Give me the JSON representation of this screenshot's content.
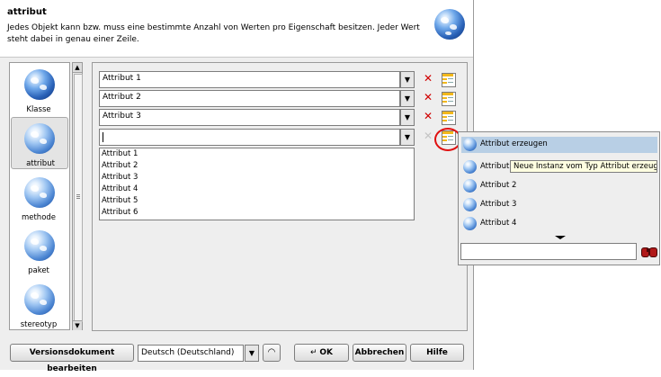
{
  "header": {
    "title": "attribut",
    "description": "Jedes Objekt kann bzw. muss eine bestimmte Anzahl von Werten pro Eigenschaft besitzen. Jeder Wert steht dabei in genau einer Zeile."
  },
  "sidebar": {
    "items": [
      {
        "label": "Klasse",
        "icon": "globe-icon"
      },
      {
        "label": "attribut",
        "icon": "globe-icon",
        "selected": true
      },
      {
        "label": "methode",
        "icon": "globe-icon"
      },
      {
        "label": "paket",
        "icon": "globe-icon"
      },
      {
        "label": "stereotyp",
        "icon": "globe-icon"
      }
    ]
  },
  "fields": [
    {
      "value": "Attribut 1"
    },
    {
      "value": "Attribut 2"
    },
    {
      "value": "Attribut 3"
    },
    {
      "value": ""
    }
  ],
  "dropdown_list": [
    "Attribut 1",
    "Attribut 2",
    "Attribut 3",
    "Attribut 4",
    "Attribut 5",
    "Attribut 6"
  ],
  "popup": {
    "items": [
      {
        "label": "Attribut erzeugen",
        "selected": true
      },
      {
        "label": "Attribut 1"
      },
      {
        "label": "Attribut 2"
      },
      {
        "label": "Attribut 3"
      },
      {
        "label": "Attribut 4"
      }
    ],
    "tooltip": "Neue Instanz vom Typ Attribut erzeugen",
    "search_value": ""
  },
  "footer": {
    "version_button": "Versionsdokument bearbeiten",
    "language": "Deutsch (Deutschland)",
    "ok_button": "OK",
    "cancel_button": "Abbrechen",
    "help_button": "Hilfe"
  },
  "colors": {
    "delete": "#d00000",
    "selection": "#b8cfe5",
    "highlight_ring": "#e01010",
    "tooltip_bg": "#ffffe1"
  }
}
